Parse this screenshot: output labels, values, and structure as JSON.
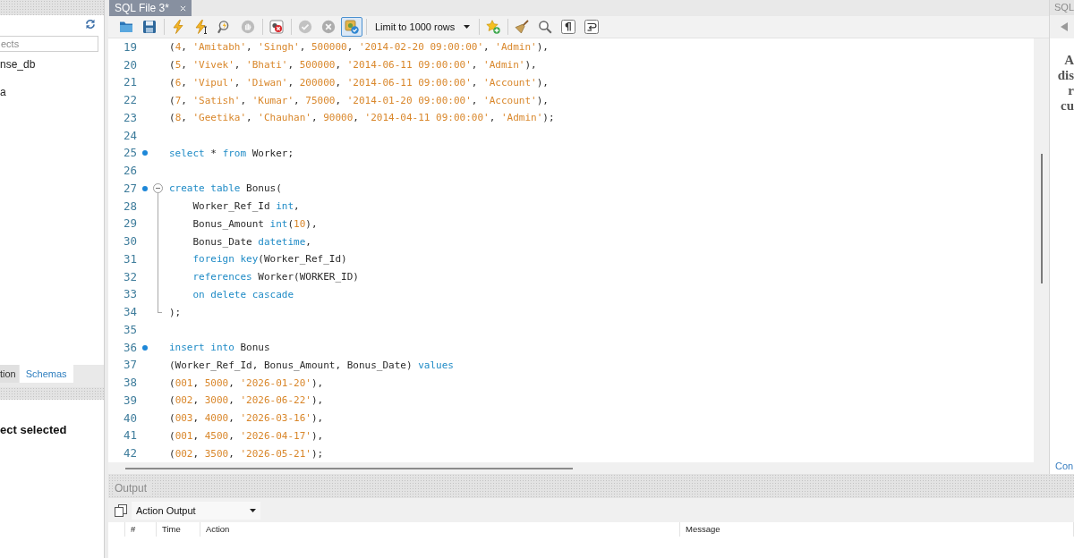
{
  "navigator": {
    "search": {
      "placeholder": "ects"
    },
    "items": [
      {
        "label": "nse_db"
      },
      {
        "label": "a"
      }
    ],
    "tabs": [
      {
        "label": "tion",
        "selected": false
      },
      {
        "label": "Schemas",
        "selected": true
      }
    ],
    "info_message": "ect selected"
  },
  "editor": {
    "tabs": [
      {
        "label": "SQL File 3*",
        "selected": true
      }
    ],
    "toolbar": [
      {
        "kind": "open",
        "disabled": false,
        "pressed": false
      },
      {
        "kind": "save",
        "disabled": false,
        "pressed": false
      },
      {
        "kind": "separator"
      },
      {
        "kind": "execute",
        "disabled": false,
        "pressed": false
      },
      {
        "kind": "executeline",
        "disabled": false,
        "pressed": false
      },
      {
        "kind": "explain",
        "disabled": false,
        "pressed": false
      },
      {
        "kind": "stop",
        "disabled": true,
        "pressed": false
      },
      {
        "kind": "separator"
      },
      {
        "kind": "errors",
        "disabled": false,
        "pressed": false
      },
      {
        "kind": "separator"
      },
      {
        "kind": "commit",
        "disabled": true,
        "pressed": false
      },
      {
        "kind": "rollback",
        "disabled": true,
        "pressed": false
      },
      {
        "kind": "autocommit",
        "disabled": false,
        "pressed": true
      },
      {
        "kind": "separator"
      },
      {
        "kind": "limit",
        "value": "Limit to 1000 rows"
      },
      {
        "kind": "separator"
      },
      {
        "kind": "snippet",
        "disabled": false,
        "pressed": false
      },
      {
        "kind": "separator"
      },
      {
        "kind": "beautify",
        "disabled": false,
        "pressed": false
      },
      {
        "kind": "find",
        "disabled": false,
        "pressed": false
      },
      {
        "kind": "invisibles",
        "disabled": false,
        "pressed": false
      },
      {
        "kind": "wrap",
        "disabled": false,
        "pressed": false
      }
    ],
    "lines": [
      {
        "number": "19",
        "marker": false,
        "tokens": [
          {
            "kind": "plain",
            "text": "("
          },
          {
            "kind": "literal",
            "text": "4"
          },
          {
            "kind": "plain",
            "text": ", "
          },
          {
            "kind": "literal",
            "text": "'Amitabh'"
          },
          {
            "kind": "plain",
            "text": ", "
          },
          {
            "kind": "literal",
            "text": "'Singh'"
          },
          {
            "kind": "plain",
            "text": ", "
          },
          {
            "kind": "literal",
            "text": "500000"
          },
          {
            "kind": "plain",
            "text": ", "
          },
          {
            "kind": "literal",
            "text": "'2014-02-20 09:00:00'"
          },
          {
            "kind": "plain",
            "text": ", "
          },
          {
            "kind": "literal",
            "text": "'Admin'"
          },
          {
            "kind": "plain",
            "text": "),"
          }
        ]
      },
      {
        "number": "20",
        "marker": false,
        "tokens": [
          {
            "kind": "plain",
            "text": "("
          },
          {
            "kind": "literal",
            "text": "5"
          },
          {
            "kind": "plain",
            "text": ", "
          },
          {
            "kind": "literal",
            "text": "'Vivek'"
          },
          {
            "kind": "plain",
            "text": ", "
          },
          {
            "kind": "literal",
            "text": "'Bhati'"
          },
          {
            "kind": "plain",
            "text": ", "
          },
          {
            "kind": "literal",
            "text": "500000"
          },
          {
            "kind": "plain",
            "text": ", "
          },
          {
            "kind": "literal",
            "text": "'2014-06-11 09:00:00'"
          },
          {
            "kind": "plain",
            "text": ", "
          },
          {
            "kind": "literal",
            "text": "'Admin'"
          },
          {
            "kind": "plain",
            "text": "),"
          }
        ]
      },
      {
        "number": "21",
        "marker": false,
        "tokens": [
          {
            "kind": "plain",
            "text": "("
          },
          {
            "kind": "literal",
            "text": "6"
          },
          {
            "kind": "plain",
            "text": ", "
          },
          {
            "kind": "literal",
            "text": "'Vipul'"
          },
          {
            "kind": "plain",
            "text": ", "
          },
          {
            "kind": "literal",
            "text": "'Diwan'"
          },
          {
            "kind": "plain",
            "text": ", "
          },
          {
            "kind": "literal",
            "text": "200000"
          },
          {
            "kind": "plain",
            "text": ", "
          },
          {
            "kind": "literal",
            "text": "'2014-06-11 09:00:00'"
          },
          {
            "kind": "plain",
            "text": ", "
          },
          {
            "kind": "literal",
            "text": "'Account'"
          },
          {
            "kind": "plain",
            "text": "),"
          }
        ]
      },
      {
        "number": "22",
        "marker": false,
        "tokens": [
          {
            "kind": "plain",
            "text": "("
          },
          {
            "kind": "literal",
            "text": "7"
          },
          {
            "kind": "plain",
            "text": ", "
          },
          {
            "kind": "literal",
            "text": "'Satish'"
          },
          {
            "kind": "plain",
            "text": ", "
          },
          {
            "kind": "literal",
            "text": "'Kumar'"
          },
          {
            "kind": "plain",
            "text": ", "
          },
          {
            "kind": "literal",
            "text": "75000"
          },
          {
            "kind": "plain",
            "text": ", "
          },
          {
            "kind": "literal",
            "text": "'2014-01-20 09:00:00'"
          },
          {
            "kind": "plain",
            "text": ", "
          },
          {
            "kind": "literal",
            "text": "'Account'"
          },
          {
            "kind": "plain",
            "text": "),"
          }
        ]
      },
      {
        "number": "23",
        "marker": false,
        "tokens": [
          {
            "kind": "plain",
            "text": "("
          },
          {
            "kind": "literal",
            "text": "8"
          },
          {
            "kind": "plain",
            "text": ", "
          },
          {
            "kind": "literal",
            "text": "'Geetika'"
          },
          {
            "kind": "plain",
            "text": ", "
          },
          {
            "kind": "literal",
            "text": "'Chauhan'"
          },
          {
            "kind": "plain",
            "text": ", "
          },
          {
            "kind": "literal",
            "text": "90000"
          },
          {
            "kind": "plain",
            "text": ", "
          },
          {
            "kind": "literal",
            "text": "'2014-04-11 09:00:00'"
          },
          {
            "kind": "plain",
            "text": ", "
          },
          {
            "kind": "literal",
            "text": "'Admin'"
          },
          {
            "kind": "plain",
            "text": ");"
          }
        ]
      },
      {
        "number": "24",
        "marker": false
      },
      {
        "number": "25",
        "marker": true,
        "tokens": [
          {
            "kind": "keyword",
            "text": "select"
          },
          {
            "kind": "plain",
            "text": " * "
          },
          {
            "kind": "keyword",
            "text": "from"
          },
          {
            "kind": "plain",
            "text": " Worker;"
          }
        ]
      },
      {
        "number": "26",
        "marker": false
      },
      {
        "number": "27",
        "marker": true,
        "expanded": true,
        "tokens": [
          {
            "kind": "keyword",
            "text": "create table"
          },
          {
            "kind": "plain",
            "text": " Bonus("
          }
        ],
        "children": [
          {
            "number": "28",
            "marker": false,
            "tokens": [
              {
                "kind": "plain",
                "text": "Worker_Ref_Id "
              },
              {
                "kind": "keyword",
                "text": "int"
              },
              {
                "kind": "plain",
                "text": ","
              }
            ]
          },
          {
            "number": "29",
            "marker": false,
            "tokens": [
              {
                "kind": "plain",
                "text": "Bonus_Amount "
              },
              {
                "kind": "keyword",
                "text": "int"
              },
              {
                "kind": "plain",
                "text": "("
              },
              {
                "kind": "literal",
                "text": "10"
              },
              {
                "kind": "plain",
                "text": "),"
              }
            ]
          },
          {
            "number": "30",
            "marker": false,
            "tokens": [
              {
                "kind": "plain",
                "text": "Bonus_Date "
              },
              {
                "kind": "keyword",
                "text": "datetime"
              },
              {
                "kind": "plain",
                "text": ","
              }
            ]
          },
          {
            "number": "31",
            "marker": false,
            "tokens": [
              {
                "kind": "keyword",
                "text": "foreign key"
              },
              {
                "kind": "plain",
                "text": "(Worker_Ref_Id)"
              }
            ]
          },
          {
            "number": "32",
            "marker": false,
            "tokens": [
              {
                "kind": "keyword",
                "text": "references"
              },
              {
                "kind": "plain",
                "text": " Worker(WORKER_ID)"
              }
            ]
          },
          {
            "number": "33",
            "marker": false,
            "tokens": [
              {
                "kind": "keyword",
                "text": "on delete cascade"
              }
            ]
          }
        ]
      },
      {
        "number": "34",
        "marker": false,
        "tokens": [
          {
            "kind": "plain",
            "text": ");"
          }
        ]
      },
      {
        "number": "35",
        "marker": false
      },
      {
        "number": "36",
        "marker": true,
        "tokens": [
          {
            "kind": "keyword",
            "text": "insert into"
          },
          {
            "kind": "plain",
            "text": " Bonus"
          }
        ]
      },
      {
        "number": "37",
        "marker": false,
        "tokens": [
          {
            "kind": "plain",
            "text": "(Worker_Ref_Id, Bonus_Amount, Bonus_Date) "
          },
          {
            "kind": "keyword",
            "text": "values"
          }
        ]
      },
      {
        "number": "38",
        "marker": false,
        "tokens": [
          {
            "kind": "plain",
            "text": "("
          },
          {
            "kind": "literal",
            "text": "001"
          },
          {
            "kind": "plain",
            "text": ", "
          },
          {
            "kind": "literal",
            "text": "5000"
          },
          {
            "kind": "plain",
            "text": ", "
          },
          {
            "kind": "literal",
            "text": "'2026-01-20'"
          },
          {
            "kind": "plain",
            "text": "),"
          }
        ]
      },
      {
        "number": "39",
        "marker": false,
        "tokens": [
          {
            "kind": "plain",
            "text": "("
          },
          {
            "kind": "literal",
            "text": "002"
          },
          {
            "kind": "plain",
            "text": ", "
          },
          {
            "kind": "literal",
            "text": "3000"
          },
          {
            "kind": "plain",
            "text": ", "
          },
          {
            "kind": "literal",
            "text": "'2026-06-22'"
          },
          {
            "kind": "plain",
            "text": "),"
          }
        ]
      },
      {
        "number": "40",
        "marker": false,
        "tokens": [
          {
            "kind": "plain",
            "text": "("
          },
          {
            "kind": "literal",
            "text": "003"
          },
          {
            "kind": "plain",
            "text": ", "
          },
          {
            "kind": "literal",
            "text": "4000"
          },
          {
            "kind": "plain",
            "text": ", "
          },
          {
            "kind": "literal",
            "text": "'2026-03-16'"
          },
          {
            "kind": "plain",
            "text": "),"
          }
        ]
      },
      {
        "number": "41",
        "marker": false,
        "tokens": [
          {
            "kind": "plain",
            "text": "("
          },
          {
            "kind": "literal",
            "text": "001"
          },
          {
            "kind": "plain",
            "text": ", "
          },
          {
            "kind": "literal",
            "text": "4500"
          },
          {
            "kind": "plain",
            "text": ", "
          },
          {
            "kind": "literal",
            "text": "'2026-04-17'"
          },
          {
            "kind": "plain",
            "text": "),"
          }
        ]
      },
      {
        "number": "42",
        "marker": false,
        "tokens": [
          {
            "kind": "plain",
            "text": "("
          },
          {
            "kind": "literal",
            "text": "002"
          },
          {
            "kind": "plain",
            "text": ", "
          },
          {
            "kind": "literal",
            "text": "3500"
          },
          {
            "kind": "plain",
            "text": ", "
          },
          {
            "kind": "literal",
            "text": "'2026-05-21'"
          },
          {
            "kind": "plain",
            "text": ");"
          }
        ]
      }
    ]
  },
  "context_help": {
    "title": "SQL",
    "text_lines": [
      "A",
      "dis",
      "r",
      "cu"
    ],
    "link": "Con"
  },
  "output": {
    "title": "Output",
    "view": "Action Output",
    "columns": [
      "#",
      "Time",
      "Action",
      "Message"
    ]
  }
}
